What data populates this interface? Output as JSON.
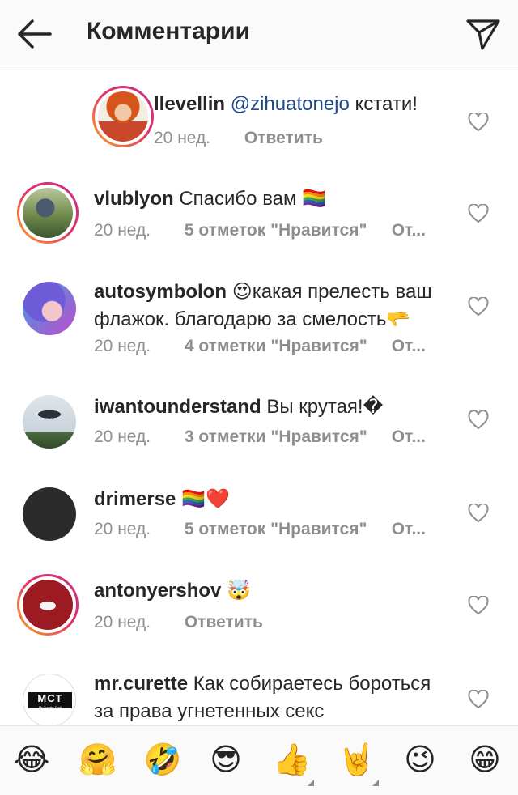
{
  "header": {
    "title": "Комментарии",
    "back_icon": "arrow-left-icon",
    "send_icon": "paper-plane-icon"
  },
  "comments": [
    {
      "username": "llevellin",
      "mention": "@zihuatonejo",
      "text": " кстати!",
      "time": "20 нед.",
      "action": "Ответить"
    },
    {
      "username": "vlublyon",
      "text": "Спасибо вам 🏳️‍🌈",
      "time": "20 нед.",
      "likes": "5 отметок \"Нравится\"",
      "reply": "От..."
    },
    {
      "username": "autosymbolon",
      "text": "😍какая прелесть ваш флажок. благодарю за смелость🫳",
      "time": "20 нед.",
      "likes": "4 отметки \"Нравится\"",
      "reply": "От..."
    },
    {
      "username": "iwantounderstand",
      "text": "Вы крутая!�",
      "time": "20 нед.",
      "likes": "3 отметки \"Нравится\"",
      "reply": "От..."
    },
    {
      "username": "drimerse",
      "text": "🏳️‍🌈❤️",
      "time": "20 нед.",
      "likes": "5 отметок \"Нравится\"",
      "reply": "От..."
    },
    {
      "username": "antonyershov",
      "text": "🤯",
      "time": "20 нед.",
      "action": "Ответить"
    },
    {
      "username": "mr.curette",
      "text": "Как собираетесь бороться за права угнетенных секс меньшинств?",
      "avatar_text": "MCT",
      "avatar_subtext": "Mr.Curette Tech"
    }
  ],
  "emoji_bar": [
    "😂",
    "🤗",
    "🤣",
    "😎",
    "👍",
    "🤘",
    "😉",
    "😁"
  ],
  "colors": {
    "accent_mention": "#1e4a8c",
    "story_ring": "#e1306c",
    "meta_gray": "#8e8e8e"
  }
}
